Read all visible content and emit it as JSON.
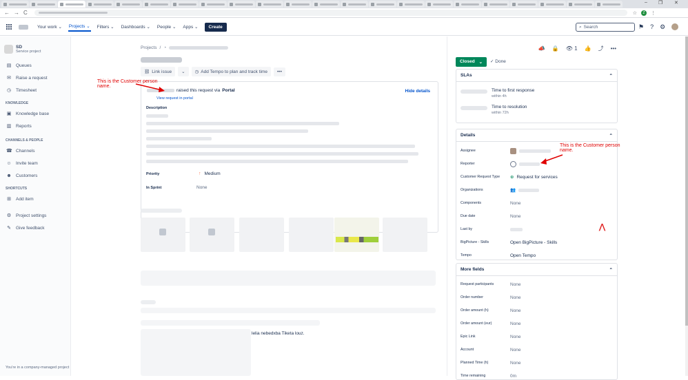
{
  "browser": {
    "window_controls": [
      "–",
      "❐",
      "✕"
    ],
    "nav": [
      "←",
      "→",
      "C"
    ],
    "tools": [
      "☆",
      "⋮"
    ],
    "profile_initial": "Z"
  },
  "topbar": {
    "nav_items": [
      "Your work ⌄",
      "Projects ⌄",
      "Filters ⌄",
      "Dashboards ⌄",
      "People ⌄",
      "Apps ⌄"
    ],
    "create_label": "Create",
    "search_placeholder": "Search"
  },
  "sidebar": {
    "project_name": "SD",
    "project_type": "Service project",
    "items_top": [
      {
        "icon": "queues-icon",
        "glyph": "▤",
        "label": "Queues"
      },
      {
        "icon": "raise-request-icon",
        "glyph": "✉",
        "label": "Raise a request"
      },
      {
        "icon": "timesheet-icon",
        "glyph": "◷",
        "label": "Timesheet"
      }
    ],
    "section_kb": "KNOWLEDGE",
    "items_kb": [
      {
        "icon": "knowledge-base-icon",
        "glyph": "▣",
        "label": "Knowledge base"
      },
      {
        "icon": "reports-icon",
        "glyph": "▥",
        "label": "Reports"
      }
    ],
    "section_channels": "CHANNELS & PEOPLE",
    "items_channels": [
      {
        "icon": "channels-icon",
        "glyph": "☎",
        "label": "Channels"
      },
      {
        "icon": "invite-team-icon",
        "glyph": "☺",
        "label": "Invite team"
      },
      {
        "icon": "customers-icon",
        "glyph": "☻",
        "label": "Customers"
      }
    ],
    "section_shortcuts": "SHORTCUTS",
    "items_shortcuts": [
      {
        "icon": "add-item-icon",
        "glyph": "⊞",
        "label": "Add item"
      }
    ],
    "items_bottom": [
      {
        "icon": "settings-icon",
        "glyph": "⚙",
        "label": "Project settings"
      },
      {
        "icon": "feedback-icon",
        "glyph": "✎",
        "label": "Give feedback"
      }
    ],
    "footer": "You're in a company-managed project"
  },
  "main": {
    "breadcrumb_root": "Projects",
    "breadcrumb_sep": "/",
    "actions": {
      "link_issue": "Link issue",
      "tempo": "Add Tempo to plan and track time",
      "more": "•••"
    },
    "raised_text": "raised this request via",
    "raised_channel": "Portal",
    "view_request": "View request in portal",
    "hide_details": "Hide details",
    "description_label": "Description",
    "priority_label": "Priority",
    "priority_value": "Medium",
    "sprint_label": "In Sprint",
    "sprint_value": "None",
    "comment_fragment": "lelia nebedxba Tiketa louz."
  },
  "annotations": {
    "left": "This is the Customer person name.",
    "right": "This is the Customer person name."
  },
  "right": {
    "watch_count": "1",
    "status": "Closed",
    "status_chevron": "⌄",
    "done_label": "Done",
    "slas_title": "SLAs",
    "sla_items": [
      {
        "name": "Time to first response",
        "sub": "within 4h"
      },
      {
        "name": "Time to resolution",
        "sub": "within 72h"
      }
    ],
    "details_title": "Details",
    "details": [
      {
        "label": "Assignee",
        "value": "",
        "kind": "avatar-blur"
      },
      {
        "label": "Reporter",
        "value": "",
        "kind": "reporter-blur"
      },
      {
        "label": "Customer Request Type",
        "value": "Request for services",
        "kind": "crt"
      },
      {
        "label": "Organizations",
        "value": "",
        "kind": "org-blur"
      },
      {
        "label": "Components",
        "value": "None",
        "kind": "text"
      },
      {
        "label": "Due date",
        "value": "None",
        "kind": "text"
      },
      {
        "label": "Last by",
        "value": "",
        "kind": "blur"
      },
      {
        "label": "BigPicture - Skills",
        "value": "Open BigPicture - Skills",
        "kind": "dark"
      },
      {
        "label": "Tempo",
        "value": "Open Tempo",
        "kind": "dark"
      }
    ],
    "more_title": "More fields",
    "more_fields": [
      {
        "label": "Request participants",
        "value": "None"
      },
      {
        "label": "Order number",
        "value": "None"
      },
      {
        "label": "Order amount (h)",
        "value": "None"
      },
      {
        "label": "Order amount (eur)",
        "value": "None"
      },
      {
        "label": "Epic Link",
        "value": "None"
      },
      {
        "label": "Account",
        "value": "None"
      },
      {
        "label": "Planned Time (h)",
        "value": "None"
      },
      {
        "label": "Time remaining",
        "value": "0m"
      }
    ]
  }
}
